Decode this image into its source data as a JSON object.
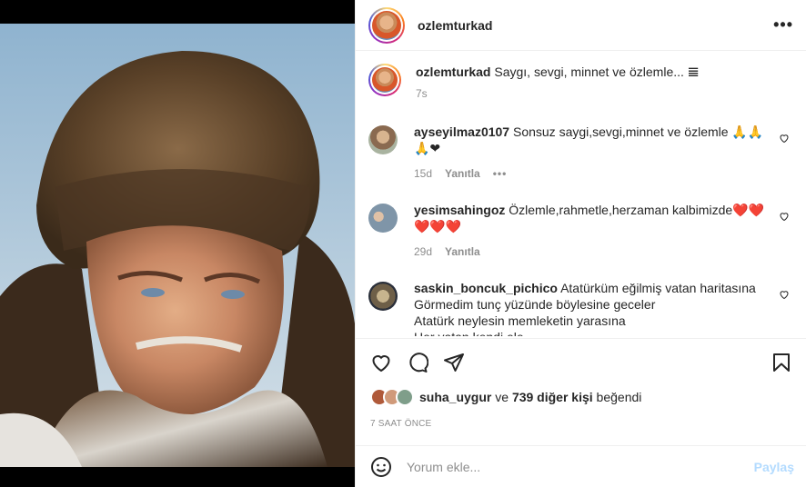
{
  "post": {
    "username": "ozlemturkad",
    "more_icon_label": "•••",
    "caption": {
      "username": "ozlemturkad",
      "text": "Saygı, sevgi, minnet ve özlemle... 𝌆",
      "time": "7s"
    }
  },
  "comments": [
    {
      "username": "ayseyilmaz0107",
      "text": "Sonsuz saygi,sevgi,minnet ve özlemle 🙏🙏🙏❤",
      "time": "15d",
      "reply": "Yanıtla",
      "more": "•••"
    },
    {
      "username": "yesimsahingoz",
      "text": "Özlemle,rahmetle,herzaman kalbimizde❤️❤️❤️❤️❤️",
      "time": "29d",
      "reply": "Yanıtla"
    },
    {
      "username": "saskin_boncuk_pichico",
      "text_lines": [
        "Atatürküm eğilmiş vatan haritasına",
        "Görmedim tunç yüzünde böylesine geceler",
        "Atatürk neylesin memleketin yarasına",
        "Her vatan kendi ele..."
      ]
    }
  ],
  "likes": {
    "user": "suha_uygur",
    "connector": " ve ",
    "others": "739 diğer kişi",
    "suffix": " beğendi"
  },
  "timestamp": "7 SAAT ÖNCE",
  "comment_box": {
    "placeholder": "Yorum ekle...",
    "post_label": "Paylaş"
  },
  "icons": {
    "like": "heart-icon",
    "comment": "comment-icon",
    "share": "share-icon",
    "save": "bookmark-icon",
    "emoji": "emoji-icon"
  }
}
